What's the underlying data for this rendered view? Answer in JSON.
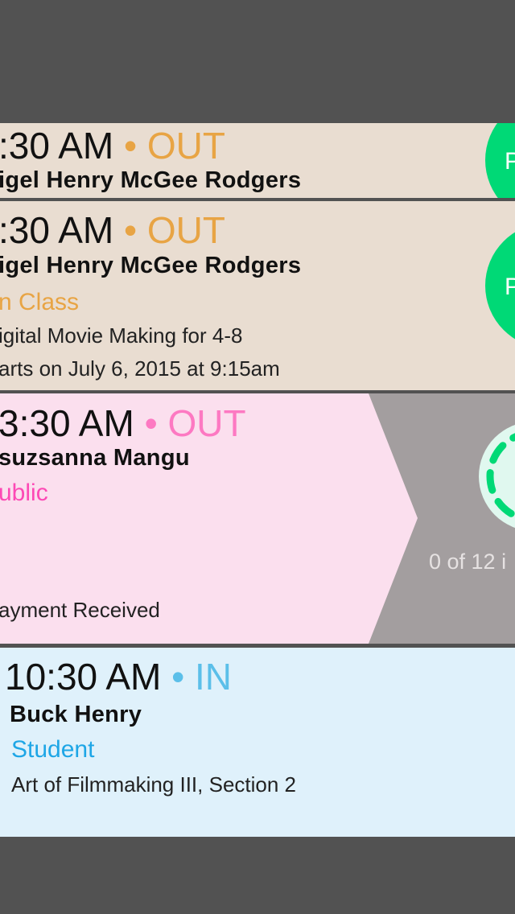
{
  "colors": {
    "background": "#525252",
    "tan": "#e9ddd1",
    "pink": "#fbdfee",
    "blue": "#dff1fb",
    "green": "#00d976",
    "orange": "#e8a444",
    "pinkAccent": "#fd79c2",
    "blueAccent": "#5bbfe9",
    "gray": "#a39e9f"
  },
  "rows": [
    {
      "time": ":30 AM",
      "dot": "•",
      "status": "OUT",
      "name": "igel Henry McGee Rodgers",
      "button_label": "P"
    },
    {
      "time": ":30 AM",
      "dot": "•",
      "status": "OUT",
      "name": "igel Henry McGee Rodgers",
      "role": "n Class",
      "details": [
        "igital Movie Making for 4-8",
        "arts on July 6, 2015 at 9:15am"
      ],
      "button_label": "P"
    },
    {
      "time": "3:30 AM",
      "dot": "•",
      "status": "OUT",
      "name": "suzsanna Mangu",
      "role": "ublic",
      "details": [
        "ayment Received"
      ],
      "progress_text": "0 of 12 i",
      "progress_value": 0
    },
    {
      "time": "10:30 AM",
      "dot": "•",
      "status": "IN",
      "name": "Buck Henry",
      "role": "Student",
      "details": [
        "Art of Filmmaking III, Section 2"
      ]
    }
  ]
}
